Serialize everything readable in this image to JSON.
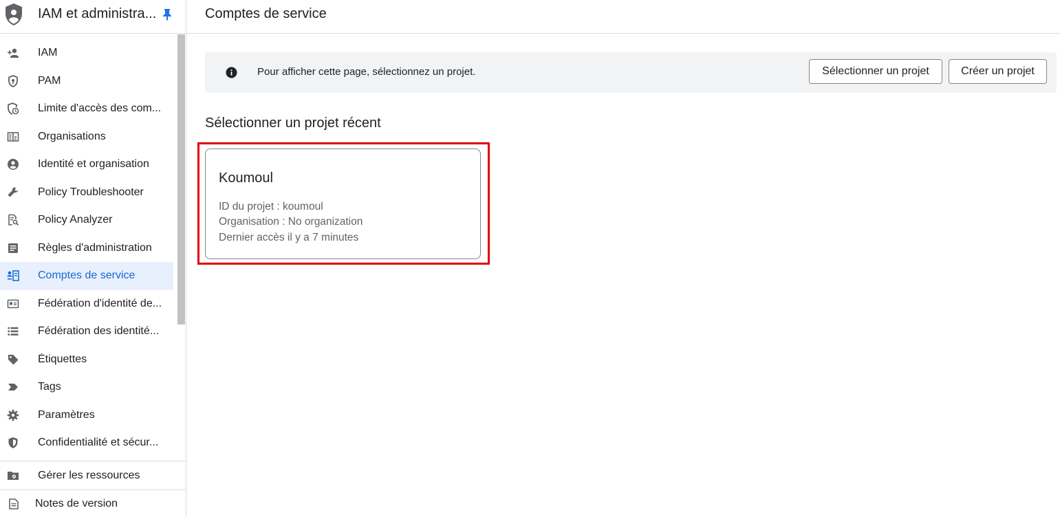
{
  "sidebar": {
    "title": "IAM et administra...",
    "items": [
      {
        "label": "IAM",
        "icon": "person-add-icon"
      },
      {
        "label": "PAM",
        "icon": "shield-key-icon"
      },
      {
        "label": "Limite d'accès des com...",
        "icon": "shield-clock-icon"
      },
      {
        "label": "Organisations",
        "icon": "building-icon"
      },
      {
        "label": "Identité et organisation",
        "icon": "account-circle-icon"
      },
      {
        "label": "Policy Troubleshooter",
        "icon": "wrench-icon"
      },
      {
        "label": "Policy Analyzer",
        "icon": "doc-search-icon"
      },
      {
        "label": "Règles d'administration",
        "icon": "document-icon"
      },
      {
        "label": "Comptes de service",
        "icon": "service-account-icon"
      },
      {
        "label": "Fédération d'identité de...",
        "icon": "id-card-icon"
      },
      {
        "label": "Fédération des identité...",
        "icon": "list-icon"
      },
      {
        "label": "Étiquettes",
        "icon": "label-icon"
      },
      {
        "label": "Tags",
        "icon": "tag-arrow-icon"
      },
      {
        "label": "Paramètres",
        "icon": "gear-icon"
      },
      {
        "label": "Confidentialité et sécur...",
        "icon": "shield-icon"
      }
    ],
    "footer_manage": "Gérer les ressources",
    "footer_notes": "Notes de version"
  },
  "header": {
    "title": "Comptes de service"
  },
  "banner": {
    "text": "Pour afficher cette page, sélectionnez un projet.",
    "select_button": "Sélectionner un projet",
    "create_button": "Créer un projet"
  },
  "recent": {
    "title": "Sélectionner un projet récent",
    "project": {
      "name": "Koumoul",
      "id_line": "ID du projet : koumoul",
      "org_line": "Organisation : No organization",
      "access_line": "Dernier accès il y a 7 minutes"
    }
  },
  "colors": {
    "accent": "#1967d2",
    "active_bg": "#e8f0fe",
    "icon": "#5f6368",
    "highlight": "#e00000"
  }
}
